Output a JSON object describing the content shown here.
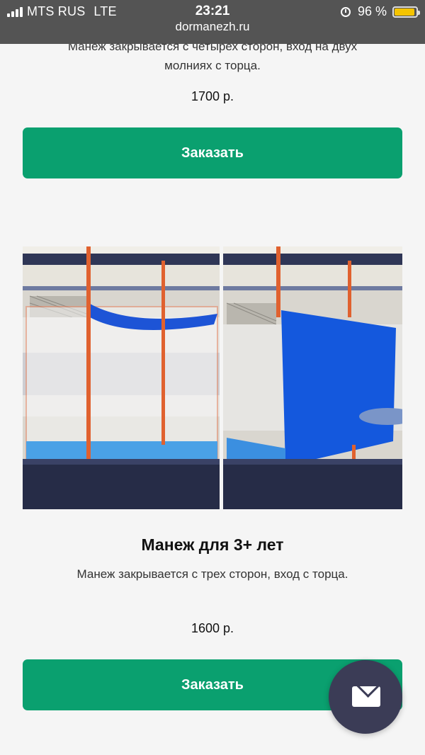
{
  "status_bar": {
    "carrier": "MTS RUS",
    "network": "LTE",
    "time": "23:21",
    "url": "dormanezh.ru",
    "battery_percent": "96 %",
    "battery_level": 0.96
  },
  "product_prev": {
    "description_partial_line1": "Манеж закрывается с четырех сторон, вход на двух",
    "description_partial_line2": "молниях с торца.",
    "price": "1700 р.",
    "order_label": "Заказать"
  },
  "product": {
    "title": "Манеж для 3+ лет",
    "description": "Манеж закрывается с трех сторон, вход с торца.",
    "price": "1600 р.",
    "order_label": "Заказать",
    "photo_left_icon": "product-photo-open-mesh",
    "photo_right_icon": "product-photo-closed-blue"
  },
  "fab": {
    "icon": "mail-icon"
  },
  "colors": {
    "accent": "#0aa06f",
    "status_bar": "#545454",
    "fab": "#3b3c56",
    "battery": "#f5c400"
  }
}
